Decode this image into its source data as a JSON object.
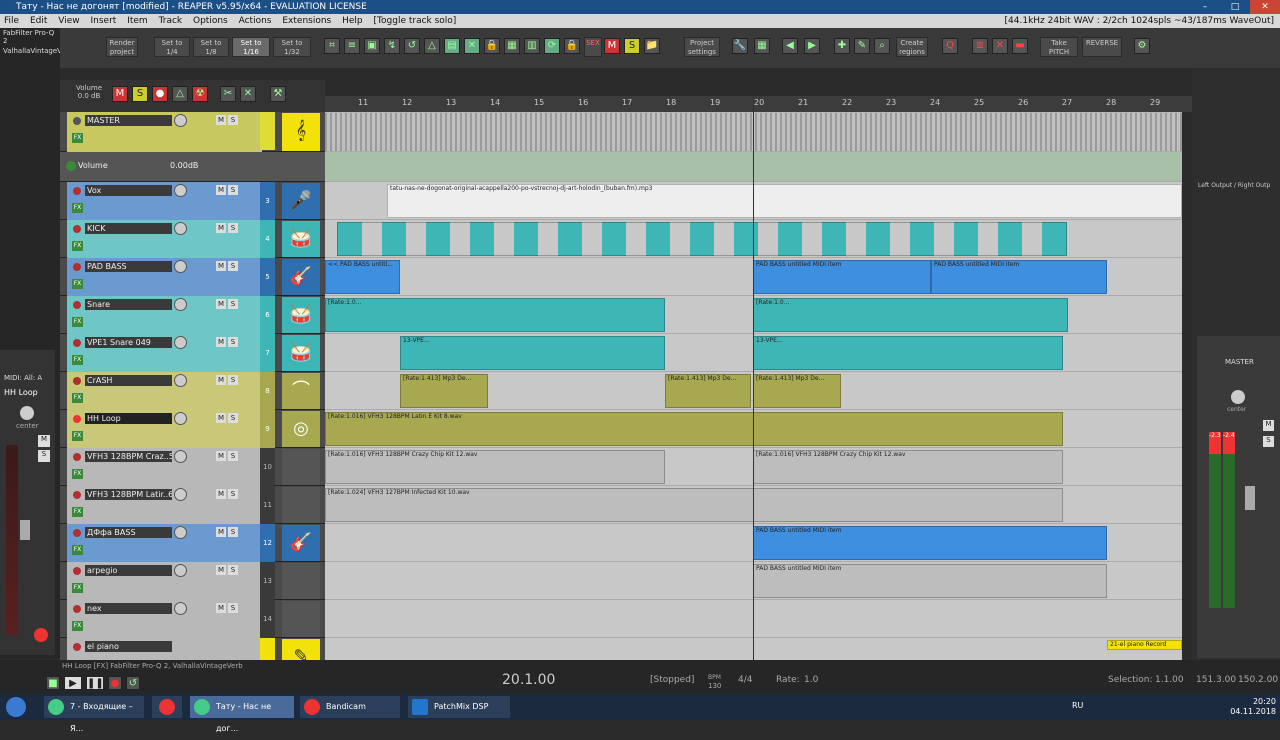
{
  "window": {
    "title": "Тату - Нас не догонят [modified] - REAPER v5.95/x64 - EVALUATION LICENSE"
  },
  "menu": {
    "items": [
      "File",
      "Edit",
      "View",
      "Insert",
      "Item",
      "Track",
      "Options",
      "Actions",
      "Extensions",
      "Help",
      "[Toggle track solo]"
    ],
    "info": "[44.1kHz 24bit WAV : 2/2ch 1024spls ~43/187ms WaveOut]"
  },
  "left_strip": {
    "fx1": "FabFilter Pro-Q 2",
    "fx2": "ValhallaVintageVe"
  },
  "toolbar": {
    "render": "Render project",
    "grid": [
      "Set to 1/4",
      "Set to 1/8",
      "Set to 1/16",
      "Set to 1/32"
    ],
    "project_settings": "Project settings",
    "create_regions": "Create regions",
    "take_pitch": "Take PITCH",
    "reverse": "REVERSE",
    "sex": "SEX"
  },
  "tcp_header": {
    "volume_label": "Volume",
    "volume_value": "0.0 dB"
  },
  "ruler": [
    "11",
    "12",
    "13",
    "14",
    "15",
    "16",
    "17",
    "18",
    "19",
    "20",
    "21",
    "22",
    "23",
    "24",
    "25",
    "26",
    "27",
    "28",
    "29"
  ],
  "tracks": [
    {
      "name": "MASTER",
      "num": ""
    },
    {
      "name": "Volume",
      "num": "",
      "value": "0.00dB"
    },
    {
      "name": "Vox",
      "num": "3"
    },
    {
      "name": "KICK",
      "num": "4"
    },
    {
      "name": "PAD BASS",
      "num": "5"
    },
    {
      "name": "Snare",
      "num": "6"
    },
    {
      "name": "VPE1 Snare 049",
      "num": "7"
    },
    {
      "name": "CrASH",
      "num": "8"
    },
    {
      "name": "HH Loop",
      "num": "9"
    },
    {
      "name": "VFH3 128BPM Craz..5",
      "num": "10"
    },
    {
      "name": "VFH3 128BPM Latir..6",
      "num": "11"
    },
    {
      "name": "ДФфа BASS",
      "num": "12"
    },
    {
      "name": "arpegio",
      "num": "13"
    },
    {
      "name": "nex",
      "num": "14"
    },
    {
      "name": "el piano",
      "num": ""
    }
  ],
  "items": {
    "vox": "tatu-nas-ne-dogonat-original-acappella200-po-vstrecnoj-dj-art-holodin_(buban.fm).mp3",
    "pad1": "<< PAD BASS untitl...",
    "pad2": "PAD BASS untitled MIDI item",
    "pad3": "PAD BASS untitled MIDI item",
    "snare": "[Rate:1.0...",
    "vpe": "13-VPE...",
    "crash": "[Rate:1.413] Mp3 De...",
    "hh": "[Rate:1.016] VFH3 128BPM Latin E Kit 8.wav",
    "craz": "[Rate:1.016] VFH3 128BPM Crazy Chip Kit 12.wav",
    "latin": "[Rate:1.024] VFH3 127BPM Infected Kit 10.wav",
    "bass": "PAD BASS untitled MIDI item",
    "arp": "PAD BASS untitled MIDI item",
    "piano": "21-el piano Record"
  },
  "left_mcp": {
    "label": "MIDI: All: A",
    "track": "HH Loop",
    "pan": "center"
  },
  "right": {
    "output": "Left Output / Right Outp",
    "master": "MASTER",
    "pan": "center",
    "peak_l": "-2.3",
    "peak_r": "-2.4"
  },
  "transport": {
    "fx_line": "HH Loop [FX] FabFilter Pro-Q 2, ValhallaVintageVerb",
    "position": "20.1.00",
    "state": "[Stopped]",
    "bpm_label": "BPM",
    "bpm": "130",
    "sig": "4/4",
    "rate_label": "Rate:",
    "rate": "1.0",
    "selection_label": "Selection:",
    "sel1": "1.1.00",
    "sel2": "151.3.00",
    "sel3": "150.2.00"
  },
  "taskbar": {
    "items": [
      "7 - Входящие – Я...",
      "Тату - Нас не дог...",
      "Bandicam",
      "PatchMix DSP"
    ],
    "lang": "RU",
    "time": "20:20",
    "date": "04.11.2018"
  },
  "colors": {
    "teal": "#3fb6b6",
    "blue": "#3f8fe0",
    "olive": "#a8a850",
    "yellow": "#f2e20a",
    "master": "#c8c860"
  }
}
